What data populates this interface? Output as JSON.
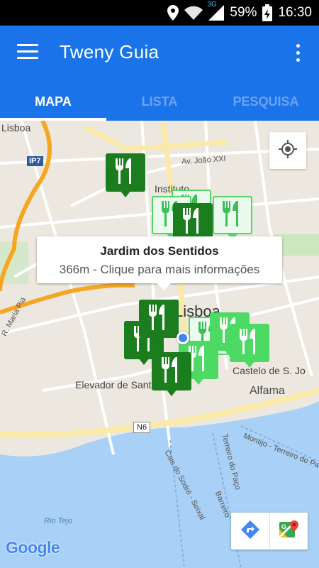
{
  "status_bar": {
    "network": "3G",
    "battery": "59%",
    "time": "16:30"
  },
  "app_bar": {
    "title": "Tweny Guia",
    "menu_icon": "hamburger-menu-icon",
    "overflow_icon": "more-vert-icon"
  },
  "tabs": [
    {
      "label": "MAPA",
      "active": true
    },
    {
      "label": "LISTA",
      "active": false
    },
    {
      "label": "PESQUISA",
      "active": false
    }
  ],
  "map": {
    "labels": {
      "lisboa_top": "Lisboa",
      "ip7": "IP7",
      "av_joao": "Av. João XXI",
      "instituto": "Instituto",
      "lisboa_center": "Lisboa",
      "castelo": "Castelo de S. Jo",
      "alfama": "Alfama",
      "elevador": "Elevador de Sant",
      "n6": "N6",
      "r_maria_pia": "R. Maria Pia",
      "montijo": "Montijo - Terreiro do Pa",
      "terreiro": "Terreiro do Paço",
      "cais": "Cais do Sodré - Seixal",
      "barreiro": "Barreiro",
      "rio_tejo": "Rio Tejo"
    },
    "tooltip": {
      "title": "Jardim dos Sentidos",
      "subtitle": "366m - Clique para mais informações"
    },
    "attribution": "Google",
    "colors": {
      "pin_dark": "#1b7d1e",
      "pin_light": "#4cd964",
      "pin_pale": "#eafbee",
      "accent": "#1a73e8"
    }
  }
}
